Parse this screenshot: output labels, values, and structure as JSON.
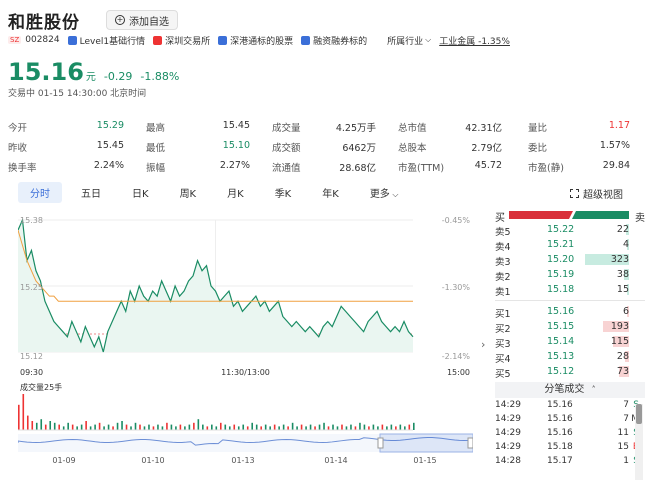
{
  "header": {
    "name": "和胜股份",
    "add_label": "添加自选"
  },
  "tags": {
    "market": "SZ",
    "code": "002824",
    "level1": "Level1基础行情",
    "exchange": "深圳交易所",
    "sgt": "深港通标的股票",
    "margin": "融资融券标的",
    "industry_label": "所属行业",
    "industry_value": "工业金属 -1.35%"
  },
  "price": {
    "last": "15.16",
    "unit": "元",
    "change": "-0.29",
    "pct": "-1.88%",
    "status": "交易中  01-15 14:30:00  北京时间"
  },
  "quote": [
    [
      {
        "l": "今开",
        "v": "15.29",
        "c": "green"
      },
      {
        "l": "最高",
        "v": "15.45",
        "c": ""
      },
      {
        "l": "成交量",
        "v": "4.25万手",
        "c": ""
      },
      {
        "l": "总市值",
        "v": "42.31亿",
        "c": ""
      },
      {
        "l": "量比",
        "v": "1.17",
        "c": "red"
      }
    ],
    [
      {
        "l": "昨收",
        "v": "15.45",
        "c": ""
      },
      {
        "l": "最低",
        "v": "15.10",
        "c": "green"
      },
      {
        "l": "成交额",
        "v": "6462万",
        "c": ""
      },
      {
        "l": "总股本",
        "v": "2.79亿",
        "c": ""
      },
      {
        "l": "委比",
        "v": "1.57%",
        "c": ""
      }
    ],
    [
      {
        "l": "换手率",
        "v": "2.24%",
        "c": ""
      },
      {
        "l": "振幅",
        "v": "2.27%",
        "c": ""
      },
      {
        "l": "流通值",
        "v": "28.68亿",
        "c": ""
      },
      {
        "l": "市盈(TTM)",
        "v": "45.72",
        "c": ""
      },
      {
        "l": "市盈(静)",
        "v": "29.84",
        "c": ""
      }
    ]
  ],
  "tabs": [
    "分时",
    "五日",
    "日K",
    "周K",
    "月K",
    "季K",
    "年K",
    "更多"
  ],
  "super_view": "超级视图",
  "chart_labels": {
    "y_top": "15.38",
    "y_mid": "15.25",
    "y_bot": "15.12",
    "pct_top": "-0.45%",
    "pct_mid": "-1.30%",
    "pct_bot": "-2.14%",
    "t_start": "09:30",
    "t_mid": "11:30/13:00",
    "t_end": "15:00",
    "vol_label": "成交量25手",
    "dates": [
      "01-09",
      "01-10",
      "01-13",
      "01-14",
      "01-15"
    ]
  },
  "chart_data": {
    "type": "line",
    "ylim": [
      15.12,
      15.38
    ],
    "price": [
      15.36,
      15.38,
      15.3,
      15.32,
      15.28,
      15.26,
      15.22,
      15.2,
      15.18,
      15.17,
      15.16,
      15.15,
      15.18,
      15.16,
      15.14,
      15.17,
      15.15,
      15.13,
      15.15,
      15.12,
      15.16,
      15.18,
      15.2,
      15.22,
      15.2,
      15.24,
      15.22,
      15.25,
      15.23,
      15.22,
      15.24,
      15.23,
      15.26,
      15.24,
      15.22,
      15.25,
      15.23,
      15.24,
      15.26,
      15.27,
      15.3,
      15.28,
      15.29,
      15.25,
      15.24,
      15.22,
      15.23,
      15.24,
      15.21,
      15.22,
      15.2,
      15.21,
      15.22,
      15.23,
      15.21,
      15.22,
      15.2,
      15.21,
      15.22,
      15.19,
      15.18,
      15.17,
      15.18,
      15.17,
      15.16,
      15.17,
      15.16,
      15.15,
      15.17,
      15.18,
      15.17,
      15.19,
      15.21,
      15.2,
      15.19,
      15.18,
      15.17,
      15.16,
      15.18,
      15.19,
      15.2,
      15.18,
      15.17,
      15.16,
      15.17,
      15.16,
      15.18,
      15.16,
      15.15
    ],
    "avg": [
      15.36,
      15.33,
      15.3,
      15.28,
      15.26,
      15.25,
      15.24,
      15.23,
      15.23,
      15.22,
      15.22,
      15.22,
      15.22,
      15.22,
      15.22,
      15.22,
      15.22,
      15.22,
      15.22,
      15.22,
      15.22,
      15.22,
      15.22,
      15.22,
      15.22,
      15.22,
      15.22,
      15.22,
      15.22,
      15.22,
      15.22,
      15.22,
      15.22,
      15.22,
      15.22,
      15.22,
      15.22,
      15.22,
      15.22,
      15.22,
      15.22,
      15.22,
      15.22,
      15.22,
      15.22,
      15.22,
      15.22,
      15.22,
      15.22,
      15.22,
      15.22,
      15.22,
      15.22,
      15.22,
      15.22,
      15.22,
      15.22,
      15.22,
      15.22,
      15.22,
      15.22,
      15.22,
      15.22,
      15.22,
      15.22,
      15.22,
      15.22,
      15.22,
      15.22,
      15.22,
      15.22,
      15.22,
      15.22,
      15.22,
      15.22,
      15.22,
      15.22,
      15.22,
      15.22,
      15.22,
      15.22,
      15.22,
      15.22,
      15.22,
      15.22,
      15.22,
      15.22,
      15.22,
      15.22
    ],
    "prev_close": 15.45,
    "volume": [
      14,
      20,
      8,
      5,
      4,
      6,
      3,
      5,
      4,
      3,
      2,
      4,
      3,
      2,
      3,
      5,
      2,
      3,
      4,
      2,
      3,
      2,
      4,
      5,
      3,
      2,
      4,
      3,
      2,
      3,
      2,
      3,
      2,
      4,
      3,
      2,
      3,
      2,
      3,
      4,
      6,
      3,
      2,
      3,
      2,
      4,
      3,
      2,
      3,
      2,
      3,
      2,
      4,
      3,
      2,
      3,
      2,
      3,
      2,
      3,
      2,
      4,
      2,
      3,
      2,
      3,
      2,
      3,
      4,
      2,
      3,
      2,
      3,
      2,
      3,
      2,
      4,
      3,
      2,
      3,
      2,
      3,
      2,
      3,
      2,
      3,
      2,
      3,
      4
    ]
  },
  "orderbook": {
    "buy_label": "买",
    "sell_label": "卖",
    "asks": [
      {
        "label": "卖5",
        "price": "15.22",
        "vol": "22",
        "bar": 0.07
      },
      {
        "label": "卖4",
        "price": "15.21",
        "vol": "4",
        "bar": 0.01
      },
      {
        "label": "卖3",
        "price": "15.20",
        "vol": "323",
        "bar": 1.0
      },
      {
        "label": "卖2",
        "price": "15.19",
        "vol": "38",
        "bar": 0.12
      },
      {
        "label": "卖1",
        "price": "15.18",
        "vol": "15",
        "bar": 0.05
      }
    ],
    "bids": [
      {
        "label": "买1",
        "price": "15.16",
        "vol": "6",
        "bar": 0.02
      },
      {
        "label": "买2",
        "price": "15.15",
        "vol": "193",
        "bar": 0.6
      },
      {
        "label": "买3",
        "price": "15.14",
        "vol": "115",
        "bar": 0.36
      },
      {
        "label": "买4",
        "price": "15.13",
        "vol": "28",
        "bar": 0.09
      },
      {
        "label": "买5",
        "price": "15.12",
        "vol": "73",
        "bar": 0.23
      }
    ],
    "trades_label": "分笔成交",
    "trades": [
      {
        "time": "14:29",
        "price": "15.16",
        "vol": "7",
        "side": "S"
      },
      {
        "time": "14:29",
        "price": "15.16",
        "vol": "7",
        "side": "M"
      },
      {
        "time": "14:29",
        "price": "15.16",
        "vol": "11",
        "side": "S"
      },
      {
        "time": "14:29",
        "price": "15.18",
        "vol": "15",
        "side": "B"
      },
      {
        "time": "14:28",
        "price": "15.17",
        "vol": "1",
        "side": "S"
      }
    ]
  }
}
